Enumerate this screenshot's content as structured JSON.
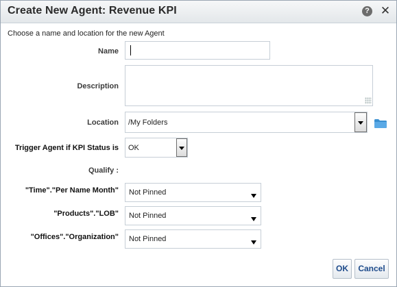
{
  "dialog": {
    "title": "Create New Agent: Revenue KPI",
    "help_glyph": "?",
    "close_glyph": "✕",
    "intro": "Choose a name and location for the new Agent"
  },
  "form": {
    "name": {
      "label": "Name",
      "value": ""
    },
    "description": {
      "label": "Description",
      "value": ""
    },
    "location": {
      "label": "Location",
      "value": "/My Folders"
    },
    "trigger": {
      "label": "Trigger Agent if KPI Status is",
      "value": "OK"
    },
    "qualify_label": "Qualify :",
    "qualifiers": [
      {
        "label": "\"Time\".\"Per Name Month\"",
        "value": "Not Pinned"
      },
      {
        "label": "\"Products\".\"LOB\"",
        "value": "Not Pinned"
      },
      {
        "label": "\"Offices\".\"Organization\"",
        "value": "Not Pinned"
      }
    ]
  },
  "buttons": {
    "ok": "OK",
    "cancel": "Cancel"
  },
  "icons": {
    "help": "help-icon",
    "close": "close-icon",
    "folder": "folder-icon",
    "dropdown": "chevron-down-icon"
  },
  "colors": {
    "button_text": "#1e4b8b",
    "folder": "#3a8fd0"
  }
}
